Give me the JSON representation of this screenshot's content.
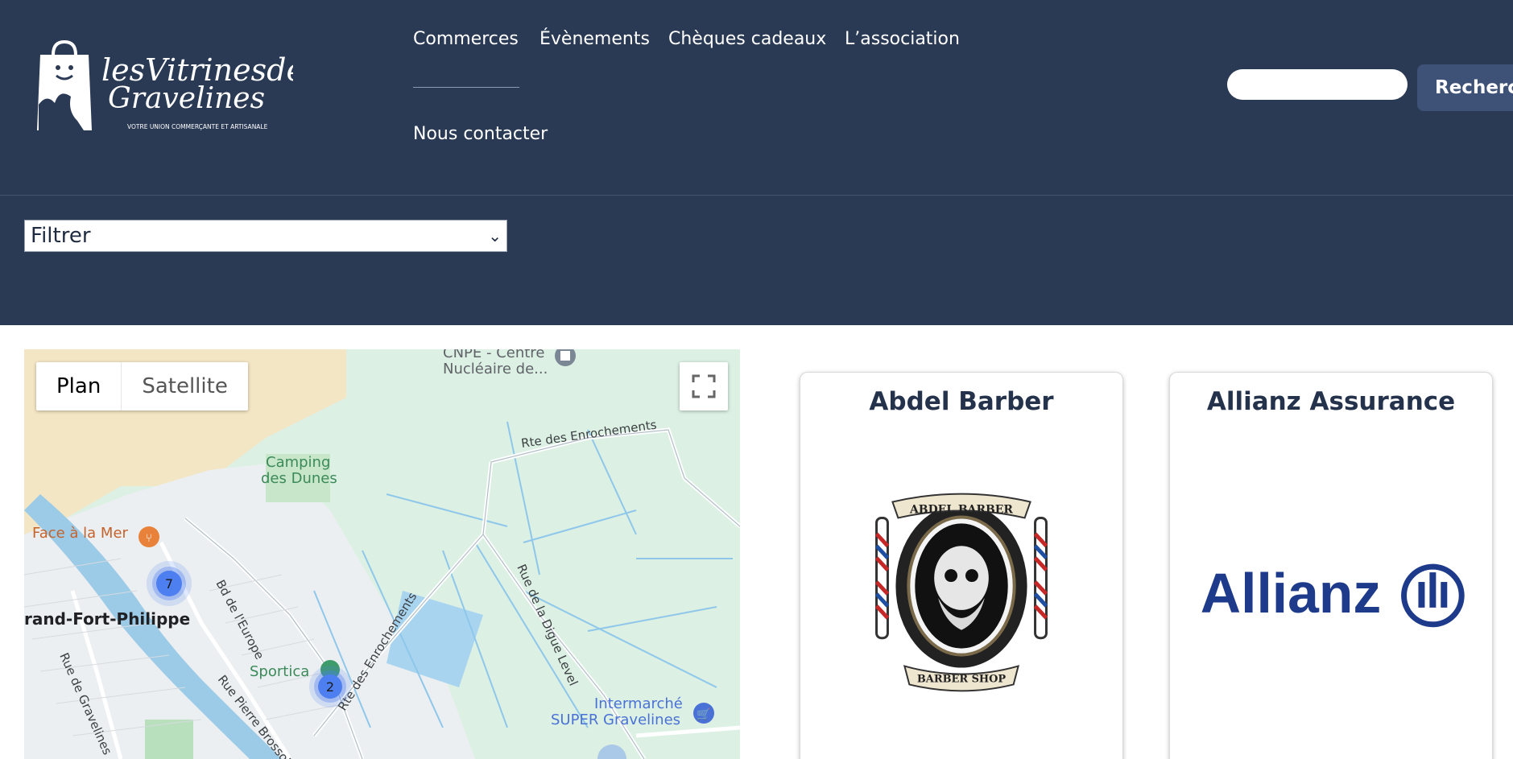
{
  "logo": {
    "line1": "lesVitrinesde",
    "line2": "Gravelines",
    "tagline": "VOTRE UNION COMMERÇANTE ET ARTISANALE"
  },
  "nav": {
    "items": [
      "Commerces",
      "Évènements",
      "Chèques cadeaux",
      "L’association",
      "Nous contacter"
    ]
  },
  "search": {
    "placeholder": "",
    "button_label": "Recherch"
  },
  "filter": {
    "selected": "Filtrer"
  },
  "map": {
    "type_buttons": [
      "Plan",
      "Satellite"
    ],
    "labels": {
      "centre": "CNPE - Centre",
      "centre2": "Nucléaire de...",
      "camping1": "Camping",
      "camping2": "des Dunes",
      "face_mer": "Face à la Mer",
      "grand_fort": "rand-Fort-Philippe",
      "sportica": "Sportica",
      "intermarche1": "Intermarché",
      "intermarche2": "SUPER Gravelines",
      "road_enroch_top": "Rte des Enrochements",
      "road_europe": "Bd de l'Europe",
      "road_enroch_mid": "Rte des Enrochements",
      "road_digue": "Rue de la Digue Level",
      "road_gravelines": "Rue de Gravelines",
      "road_pierre": "Rue Pierre Brossol"
    },
    "clusters": [
      "7",
      "2"
    ]
  },
  "cards": [
    {
      "title": "Abdel Barber",
      "logo_top": "ABDEL BARBER",
      "logo_bottom": "BARBER SHOP"
    },
    {
      "title": "Allianz Assurance",
      "logo_text": "Allianz"
    }
  ],
  "colors": {
    "header_bg": "#2a3a55",
    "accent_button": "#3e5177",
    "card_title": "#24324b",
    "allianz_blue": "#1e3a8a"
  }
}
